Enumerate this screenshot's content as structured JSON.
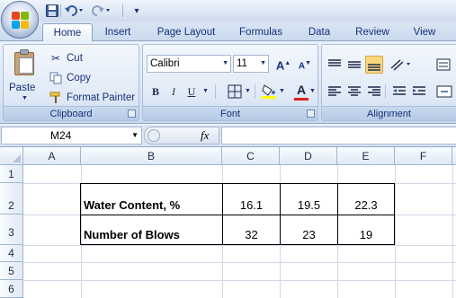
{
  "quick_access": {
    "customize_glyph": "▾"
  },
  "tabs": [
    "Home",
    "Insert",
    "Page Layout",
    "Formulas",
    "Data",
    "Review",
    "View"
  ],
  "clipboard": {
    "paste_label": "Paste",
    "cut_label": "Cut",
    "copy_label": "Copy",
    "format_painter_label": "Format Painter",
    "group_label": "Clipboard"
  },
  "font": {
    "name": "Calibri",
    "size": "11",
    "grow_label": "A",
    "shrink_label": "A",
    "bold_label": "B",
    "italic_label": "I",
    "underline_label": "U",
    "fontcolor_label": "A",
    "group_label": "Font"
  },
  "alignment": {
    "group_label": "Alignment"
  },
  "formula_bar": {
    "name_box": "M24",
    "fx_label": "fx",
    "formula": ""
  },
  "sheet": {
    "columns": [
      "A",
      "B",
      "C",
      "D",
      "E",
      "F"
    ],
    "rows": [
      "1",
      "2",
      "3",
      "4",
      "5",
      "6"
    ],
    "table": {
      "row1_label": "Water Content, %",
      "row1_values": [
        "16.1",
        "19.5",
        "22.3"
      ],
      "row2_label": "Number of Blows",
      "row2_values": [
        "32",
        "23",
        "19"
      ]
    }
  },
  "colors": {
    "accent": "#15317e",
    "ribbon": "#dbe7f6",
    "selected_align": "#f9d77e"
  }
}
